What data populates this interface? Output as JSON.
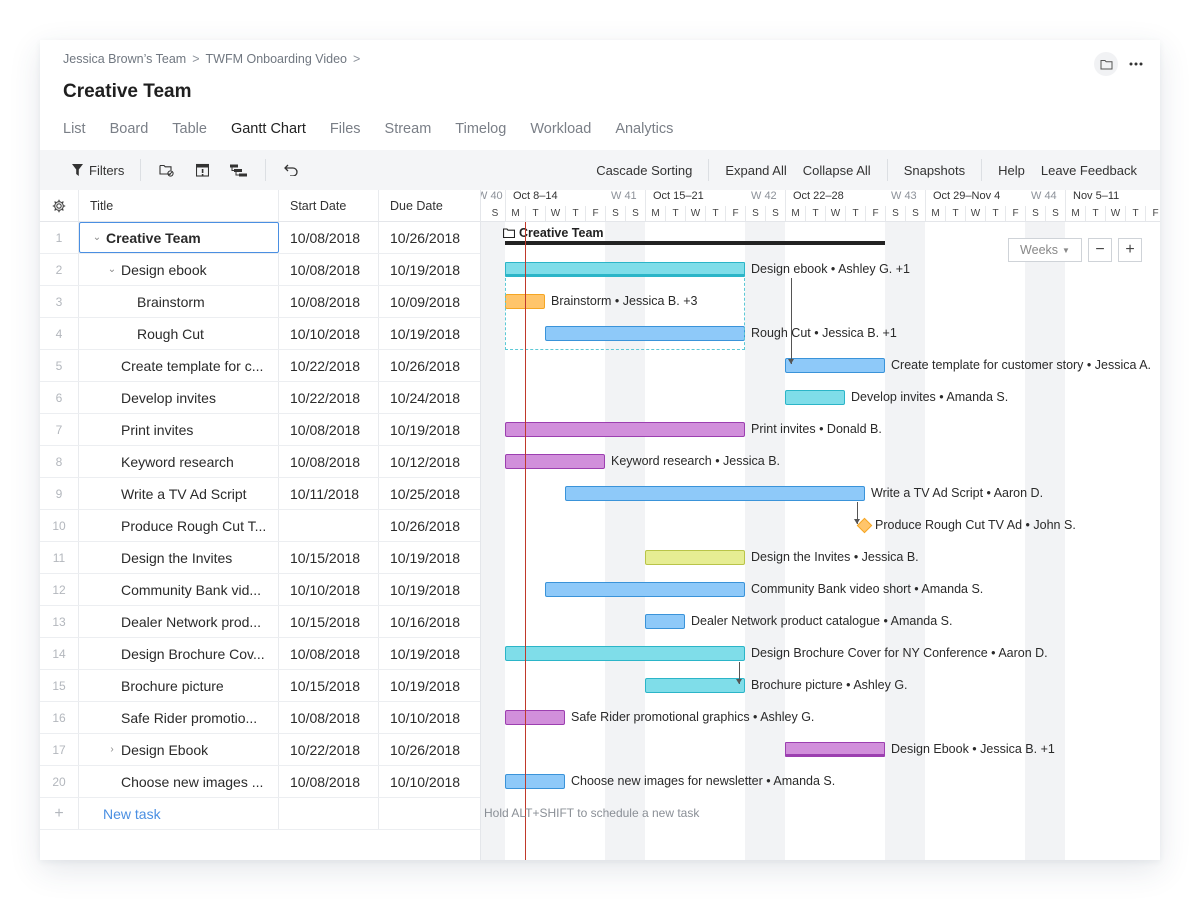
{
  "breadcrumb": [
    "Jessica Brown’s Team",
    "TWFM Onboarding Video"
  ],
  "page_title": "Creative Team",
  "top_actions": {
    "folder_icon": "folder-icon",
    "more_icon": "more-horizontal-icon"
  },
  "tabs": [
    {
      "label": "List",
      "active": false
    },
    {
      "label": "Board",
      "active": false
    },
    {
      "label": "Table",
      "active": false
    },
    {
      "label": "Gantt Chart",
      "active": true
    },
    {
      "label": "Files",
      "active": false
    },
    {
      "label": "Stream",
      "active": false
    },
    {
      "label": "Timelog",
      "active": false
    },
    {
      "label": "Workload",
      "active": false
    },
    {
      "label": "Analytics",
      "active": false
    }
  ],
  "toolbar": {
    "filters_label": "Filters",
    "icons": [
      "folder-settings-icon",
      "calendar-alert-icon",
      "hierarchy-icon",
      "undo-icon"
    ],
    "cascade_sorting": "Cascade Sorting",
    "expand_all": "Expand All",
    "collapse_all": "Collapse All",
    "snapshots": "Snapshots",
    "help": "Help",
    "leave_feedback": "Leave Feedback"
  },
  "table": {
    "columns": {
      "title": "Title",
      "start": "Start Date",
      "due": "Due Date"
    },
    "rows": [
      {
        "num": "1",
        "title": "Creative Team",
        "start": "10/08/2018",
        "due": "10/26/2018",
        "level": 0,
        "caret": "down",
        "bold": true,
        "selected": true
      },
      {
        "num": "2",
        "title": "Design ebook",
        "start": "10/08/2018",
        "due": "10/19/2018",
        "level": 1,
        "caret": "down"
      },
      {
        "num": "3",
        "title": "Brainstorm",
        "start": "10/08/2018",
        "due": "10/09/2018",
        "level": 2
      },
      {
        "num": "4",
        "title": "Rough Cut",
        "start": "10/10/2018",
        "due": "10/19/2018",
        "level": 2
      },
      {
        "num": "5",
        "title": "Create template for c...",
        "start": "10/22/2018",
        "due": "10/26/2018",
        "level": 1
      },
      {
        "num": "6",
        "title": "Develop invites",
        "start": "10/22/2018",
        "due": "10/24/2018",
        "level": 1
      },
      {
        "num": "7",
        "title": "Print invites",
        "start": "10/08/2018",
        "due": "10/19/2018",
        "level": 1
      },
      {
        "num": "8",
        "title": "Keyword research",
        "start": "10/08/2018",
        "due": "10/12/2018",
        "level": 1
      },
      {
        "num": "9",
        "title": "Write a TV Ad Script",
        "start": "10/11/2018",
        "due": "10/25/2018",
        "level": 1
      },
      {
        "num": "10",
        "title": "Produce Rough Cut T...",
        "start": "",
        "due": "10/26/2018",
        "level": 1
      },
      {
        "num": "11",
        "title": "Design the Invites",
        "start": "10/15/2018",
        "due": "10/19/2018",
        "level": 1
      },
      {
        "num": "12",
        "title": "Community Bank vid...",
        "start": "10/10/2018",
        "due": "10/19/2018",
        "level": 1
      },
      {
        "num": "13",
        "title": "Dealer Network prod...",
        "start": "10/15/2018",
        "due": "10/16/2018",
        "level": 1
      },
      {
        "num": "14",
        "title": "Design Brochure Cov...",
        "start": "10/08/2018",
        "due": "10/19/2018",
        "level": 1
      },
      {
        "num": "15",
        "title": "Brochure picture",
        "start": "10/15/2018",
        "due": "10/19/2018",
        "level": 1
      },
      {
        "num": "16",
        "title": "Safe Rider promotio...",
        "start": "10/08/2018",
        "due": "10/10/2018",
        "level": 1
      },
      {
        "num": "17",
        "title": "Design Ebook",
        "start": "10/22/2018",
        "due": "10/26/2018",
        "level": 1,
        "caret": "right"
      },
      {
        "num": "20",
        "title": "Choose new images ...",
        "start": "10/08/2018",
        "due": "10/10/2018",
        "level": 1
      }
    ],
    "new_task_label": "New task",
    "new_task_icon": "+"
  },
  "gantt": {
    "weeks": [
      {
        "label": "Oct 8–14",
        "wnum": "W 41"
      },
      {
        "label": "Oct 15–21",
        "wnum": "W 42"
      },
      {
        "label": "Oct 22–28",
        "wnum": "W 43"
      },
      {
        "label": "Oct 29–Nov 4",
        "wnum": "W 44"
      },
      {
        "label": "Nov 5–11",
        "wnum": ""
      }
    ],
    "prev_week_num": "W 40",
    "day_letters": [
      "M",
      "T",
      "W",
      "T",
      "F",
      "S",
      "S"
    ],
    "today_day_index": 1,
    "zoom_select": "Weeks",
    "zoom_out": "−",
    "zoom_in": "+",
    "hint": "Hold ALT+SHIFT to schedule a new task",
    "colors": {
      "cyan": "#7fdde9",
      "cyan_border": "#2bb5c8",
      "blue": "#8ec9f9",
      "blue_border": "#3a93d9",
      "orange": "#ffc56b",
      "orange_border": "#f5a623",
      "purple": "#d18fdb",
      "purple_border": "#9c3fb0",
      "yellow": "#e6ed93",
      "yellow_border": "#b9c448",
      "today": "#c0392b"
    },
    "bars": [
      {
        "row": 0,
        "type": "project",
        "start": 0,
        "end": 18,
        "label": "Creative Team"
      },
      {
        "row": 1,
        "type": "summary",
        "start": 0,
        "end": 11,
        "color": "cyan",
        "label": "Design ebook • Ashley G. +1"
      },
      {
        "row": 2,
        "type": "task",
        "start": 0,
        "end": 1,
        "color": "orange",
        "label": "Brainstorm • Jessica B. +3"
      },
      {
        "row": 3,
        "type": "task",
        "start": 2,
        "end": 11,
        "color": "blue",
        "label": "Rough Cut • Jessica B. +1"
      },
      {
        "row": 4,
        "type": "task",
        "start": 14,
        "end": 18,
        "color": "blue",
        "label": "Create template for customer story • Jessica A."
      },
      {
        "row": 5,
        "type": "task",
        "start": 14,
        "end": 16,
        "color": "cyan",
        "label": "Develop invites • Amanda S."
      },
      {
        "row": 6,
        "type": "task",
        "start": 0,
        "end": 11,
        "color": "purple",
        "label": "Print invites • Donald B."
      },
      {
        "row": 7,
        "type": "task",
        "start": 0,
        "end": 4,
        "color": "purple",
        "label": "Keyword research • Jessica B."
      },
      {
        "row": 8,
        "type": "task",
        "start": 3,
        "end": 17,
        "color": "blue",
        "label": "Write a TV Ad Script • Aaron D."
      },
      {
        "row": 9,
        "type": "milestone",
        "start": 18,
        "end": 18,
        "color": "orange",
        "label": "Produce Rough Cut TV Ad • John S."
      },
      {
        "row": 10,
        "type": "task",
        "start": 7,
        "end": 11,
        "color": "yellow",
        "label": "Design the Invites • Jessica B."
      },
      {
        "row": 11,
        "type": "task",
        "start": 2,
        "end": 11,
        "color": "blue",
        "label": "Community Bank video short • Amanda S."
      },
      {
        "row": 12,
        "type": "task",
        "start": 7,
        "end": 8,
        "color": "blue",
        "label": "Dealer Network product catalogue • Amanda S."
      },
      {
        "row": 13,
        "type": "task",
        "start": 0,
        "end": 11,
        "color": "cyan",
        "label": "Design Brochure Cover for NY Conference • Aaron D."
      },
      {
        "row": 14,
        "type": "task",
        "start": 7,
        "end": 11,
        "color": "cyan",
        "label": "Brochure picture • Ashley G."
      },
      {
        "row": 15,
        "type": "task",
        "start": 0,
        "end": 2,
        "color": "purple",
        "label": "Safe Rider promotional graphics • Ashley G."
      },
      {
        "row": 16,
        "type": "summary",
        "start": 14,
        "end": 18,
        "color": "purple",
        "label": "Design Ebook • Jessica B. +1"
      },
      {
        "row": 17,
        "type": "task",
        "start": 0,
        "end": 2,
        "color": "blue",
        "label": "Choose new images for newsletter • Amanda S."
      }
    ],
    "dependencies": [
      {
        "from_row": 1,
        "to_row": 4,
        "from_day": 14.3
      },
      {
        "from_row": 8,
        "to_row": 9,
        "from_day": 17.6
      },
      {
        "from_row": 13,
        "to_row": 14,
        "from_day": 11.7
      }
    ]
  }
}
